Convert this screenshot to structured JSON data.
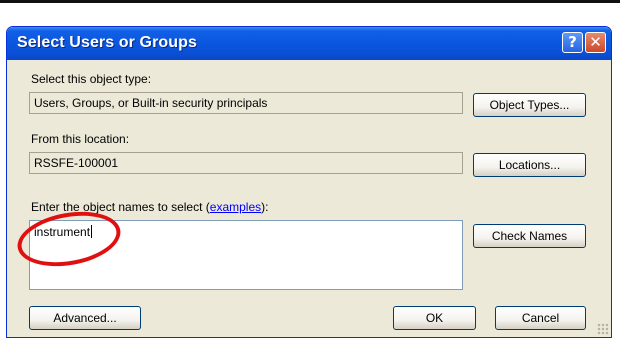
{
  "dialog": {
    "title": "Select Users or Groups",
    "help_glyph": "?",
    "close_glyph": "✕"
  },
  "object_type": {
    "label": "Select this object type:",
    "value": "Users, Groups, or Built-in security principals",
    "button": "Object Types..."
  },
  "location": {
    "label": "From this location:",
    "value": "RSSFE-100001",
    "button": "Locations..."
  },
  "names": {
    "label_prefix": "Enter the object names to select (",
    "label_link": "examples",
    "label_suffix": "):",
    "value": "instrument",
    "check_button": "Check Names"
  },
  "footer": {
    "advanced_button": "Advanced...",
    "ok_button": "OK",
    "cancel_button": "Cancel"
  },
  "colors": {
    "titlebar": "#0a58e0",
    "dialog_bg": "#ece9d8",
    "annotation": "#e01010",
    "link": "#0000ff"
  }
}
